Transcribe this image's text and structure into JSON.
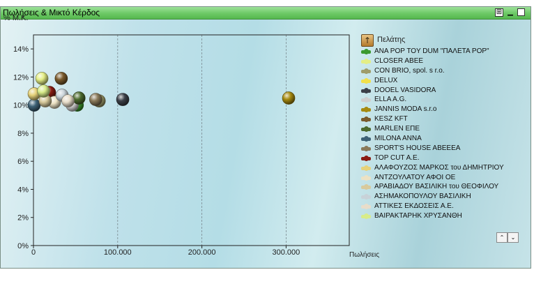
{
  "window": {
    "title": "Πωλήσεις & Μικτό Κέρδος"
  },
  "chart_data": {
    "type": "scatter",
    "xlabel": "Πωλήσεις",
    "ylabel": "% Μ.Κ.",
    "xlim": [
      0,
      375000
    ],
    "ylim": [
      0,
      15
    ],
    "x_ticks": [
      "0",
      "100.000",
      "200.000",
      "300.000"
    ],
    "y_ticks": [
      "0%",
      "2%",
      "4%",
      "6%",
      "8%",
      "10%",
      "12%",
      "14%"
    ],
    "grid": "vertical dashed",
    "legend_position": "right",
    "legend_title": "Πελάτης",
    "series": [
      {
        "name": "ANA POP TOY DUM \"ΠΑΛΕΤΑ POP\"",
        "color": "#3b9a2e",
        "points": [
          [
            52000,
            10.0
          ]
        ]
      },
      {
        "name": "CLOSER ABEE",
        "color": "#e4ee86",
        "points": [
          [
            10000,
            11.9
          ]
        ]
      },
      {
        "name": "CON BRIO, spol. s r.o.",
        "color": "#9f9d6a",
        "points": [
          [
            78000,
            10.3
          ]
        ]
      },
      {
        "name": "DELUX",
        "color": "#f1e04a",
        "points": [
          [
            21000,
            10.4
          ]
        ]
      },
      {
        "name": "DOOEL VASIDORA",
        "color": "#3c4048",
        "points": [
          [
            106000,
            10.4
          ]
        ]
      },
      {
        "name": "ELLA A.G.",
        "color": "#cfcfcf",
        "points": [
          [
            46000,
            10.0
          ]
        ]
      },
      {
        "name": "JANNIS MODA s.r.o",
        "color": "#a68a10",
        "points": [
          [
            303000,
            10.5
          ]
        ]
      },
      {
        "name": "KESZ KFT",
        "color": "#7a5a2c",
        "points": [
          [
            33000,
            11.9
          ]
        ]
      },
      {
        "name": "MARLEN ΕΠΕ",
        "color": "#4c6a2e",
        "points": [
          [
            54000,
            10.5
          ]
        ]
      },
      {
        "name": "MILONA ANNA",
        "color": "#3e6276",
        "points": [
          [
            3000,
            10.0
          ]
        ]
      },
      {
        "name": "SPORT'S HOUSE ABEEEA",
        "color": "#8a7a5a",
        "points": [
          [
            74000,
            10.4
          ]
        ]
      },
      {
        "name": "TOP CUT A.E.",
        "color": "#8a1c12",
        "points": [
          [
            19000,
            10.9
          ]
        ]
      },
      {
        "name": "ΑΛΑΦΟΥΖΟΣ ΜΑΡΚΟΣ του ΔΗΜΗΤΡΙΟΥ",
        "color": "#e6d27a",
        "points": [
          [
            6000,
            10.8
          ]
        ]
      },
      {
        "name": "ΑΝΤΖΟΥΛΑΤΟΥ ΑΦΟΙ ΟΕ",
        "color": "#ece2c4",
        "points": [
          [
            25000,
            10.2
          ]
        ]
      },
      {
        "name": "ΑΡΑΒΙΑΔΟΥ ΒΑΣΙΛΙΚΗ του ΘΕΟΦΙΛΟΥ",
        "color": "#d8ca9c",
        "points": [
          [
            14000,
            10.3
          ]
        ]
      },
      {
        "name": "ΑΣΗΜΑΚΟΠΟΥΛΟΥ ΒΑΣΙΛΙΚΗ",
        "color": "#c8d2d8",
        "points": [
          [
            34000,
            10.7
          ]
        ]
      },
      {
        "name": "ΑΤΤΙΚΕΣ ΕΚΔΟΣΕΙΣ Α.Ε.",
        "color": "#e8ddca",
        "points": [
          [
            41000,
            10.3
          ]
        ]
      },
      {
        "name": "ΒΑΙΡΑΚΤΑΡΗΚ ΧΡΥΣΑΝΘΗ",
        "color": "#d8ec8a",
        "points": [
          [
            12000,
            11.0
          ]
        ]
      }
    ]
  },
  "controls": {
    "scroll_up": "⌃",
    "scroll_down": "⌄",
    "sort": "↑"
  }
}
